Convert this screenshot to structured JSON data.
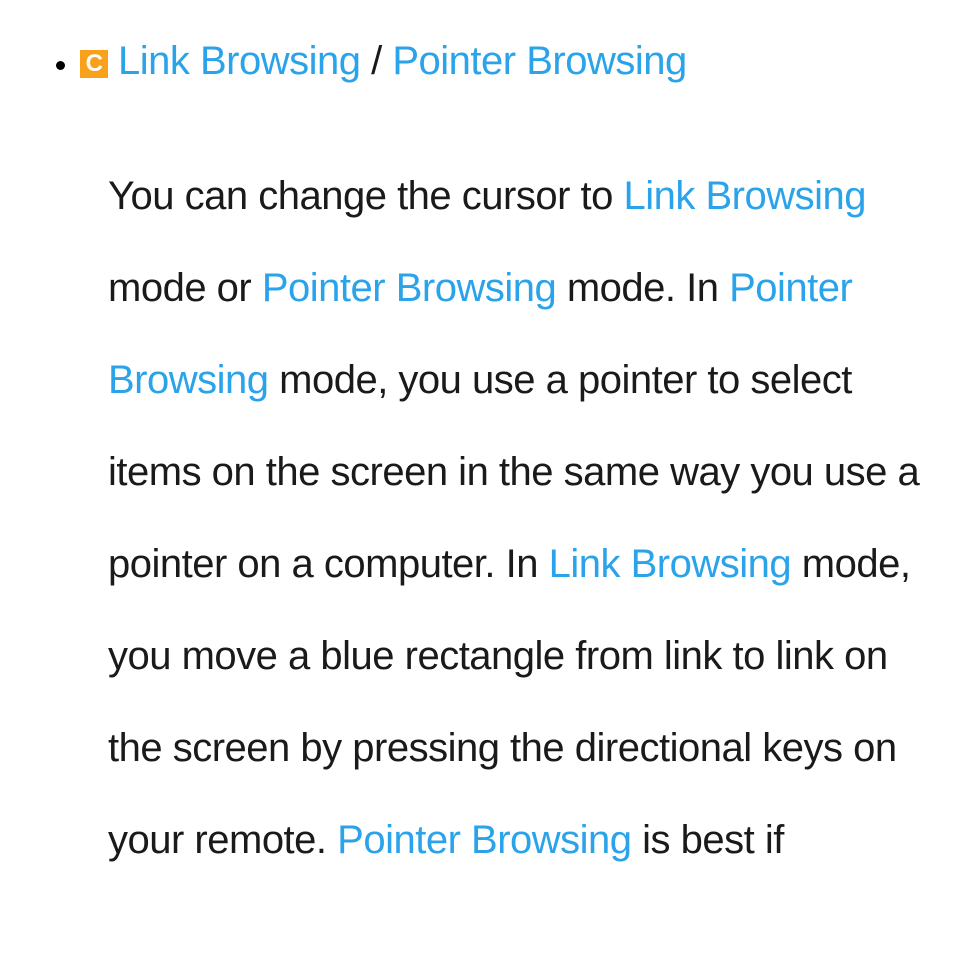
{
  "badge": "C",
  "heading": {
    "term1": "Link Browsing",
    "separator": " / ",
    "term2": "Pointer Browsing"
  },
  "paragraph": {
    "t1": "You can change the cursor to ",
    "k1": "Link Browsing",
    "t2": " mode or ",
    "k2": "Pointer Browsing",
    "t3": " mode. In ",
    "k3": "Pointer Browsing",
    "t4": " mode, you use a pointer to select items on the screen in the same way you use a pointer on a computer. In ",
    "k4": "Link Browsing",
    "t5": " mode, you move a blue rectangle from link to link on the screen by pressing the directional keys on your remote. ",
    "k5": "Pointer Browsing",
    "t6": " is best if"
  }
}
